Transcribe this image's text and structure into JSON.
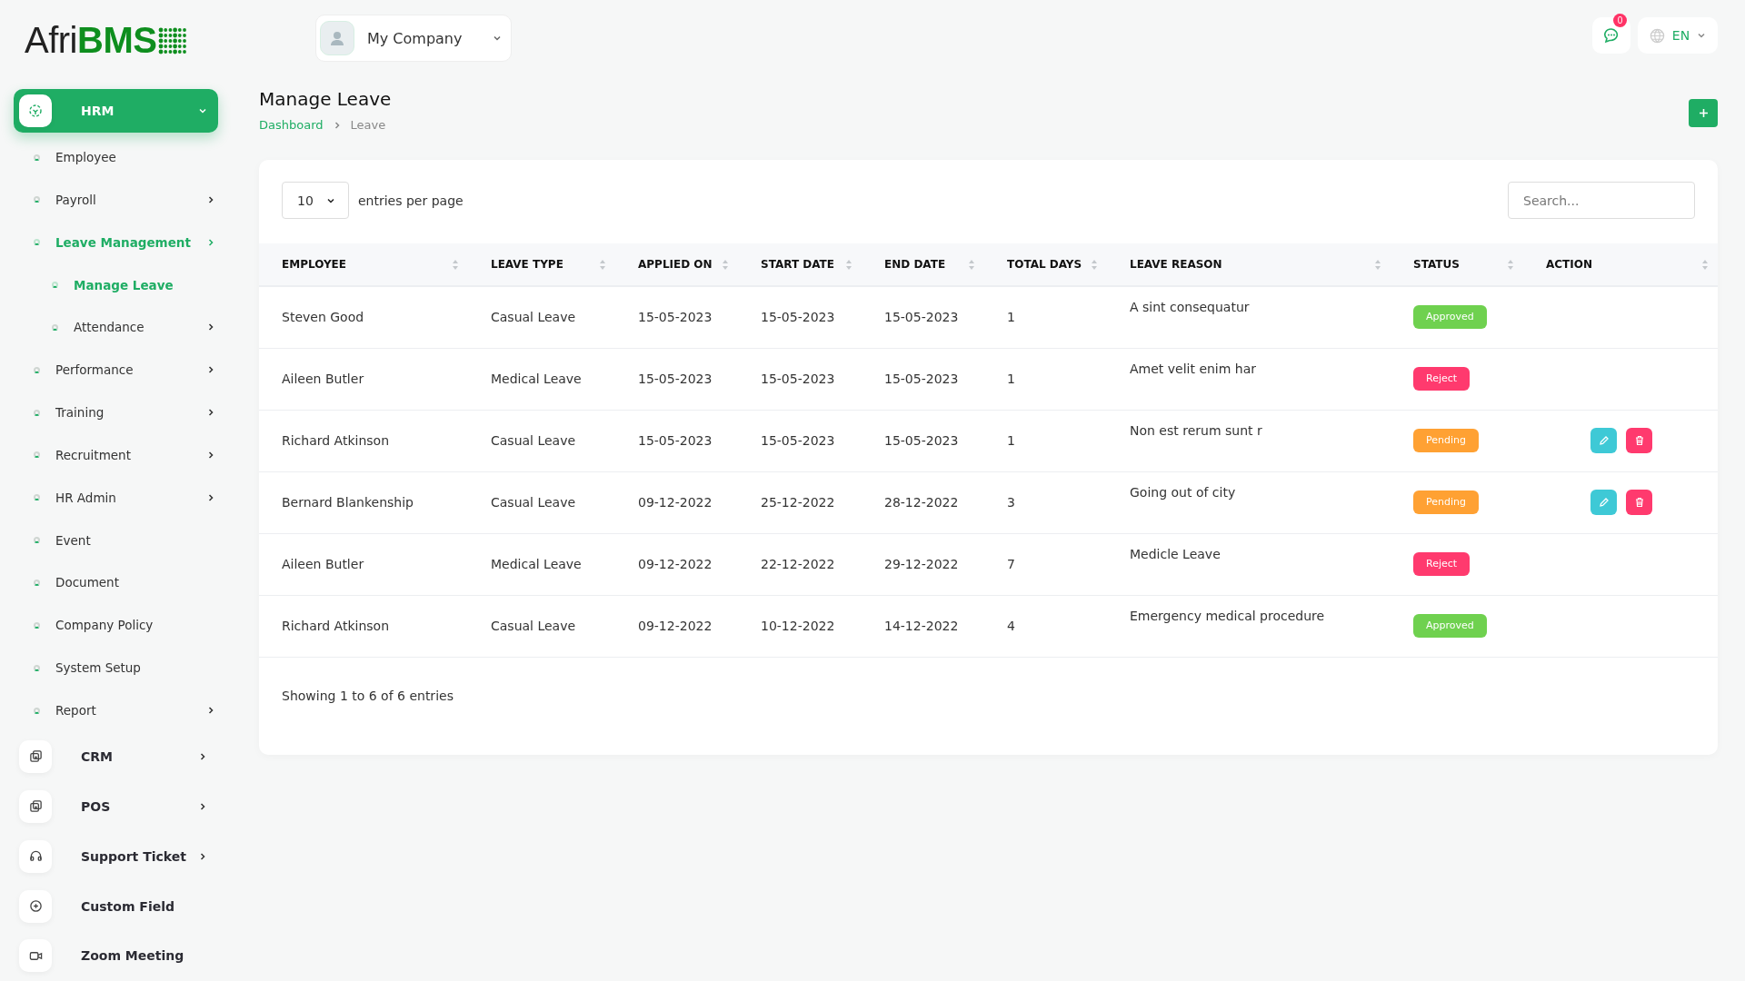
{
  "logo": {
    "light": "Afri",
    "bold": "BMS"
  },
  "company": {
    "name": "My Company"
  },
  "notifications": {
    "count": "0"
  },
  "language": {
    "code": "EN"
  },
  "sidebar": {
    "modules": [
      {
        "label": "HRM",
        "kind": "hrm",
        "selected": true,
        "expanded": true,
        "has_submenu": true,
        "children": [
          {
            "label": "Employee",
            "selected": false,
            "has_submenu": false
          },
          {
            "label": "Payroll",
            "selected": false,
            "has_submenu": true
          },
          {
            "label": "Leave Management",
            "selected": true,
            "has_submenu": true,
            "children": [
              {
                "label": "Manage Leave",
                "selected": true,
                "has_submenu": false
              },
              {
                "label": "Attendance",
                "selected": false,
                "has_submenu": true
              }
            ]
          },
          {
            "label": "Performance",
            "selected": false,
            "has_submenu": true
          },
          {
            "label": "Training",
            "selected": false,
            "has_submenu": true
          },
          {
            "label": "Recruitment",
            "selected": false,
            "has_submenu": true
          },
          {
            "label": "HR Admin",
            "selected": false,
            "has_submenu": true
          },
          {
            "label": "Event",
            "selected": false,
            "has_submenu": false
          },
          {
            "label": "Document",
            "selected": false,
            "has_submenu": false
          },
          {
            "label": "Company Policy",
            "selected": false,
            "has_submenu": false
          },
          {
            "label": "System Setup",
            "selected": false,
            "has_submenu": false
          },
          {
            "label": "Report",
            "selected": false,
            "has_submenu": true
          }
        ]
      },
      {
        "label": "CRM",
        "kind": "crm",
        "selected": false,
        "expanded": false,
        "has_submenu": true
      },
      {
        "label": "POS",
        "kind": "pos",
        "selected": false,
        "expanded": false,
        "has_submenu": true
      },
      {
        "label": "Support Ticket",
        "kind": "support",
        "selected": false,
        "expanded": false,
        "has_submenu": true
      },
      {
        "label": "Custom Field",
        "kind": "custom",
        "selected": false,
        "expanded": false,
        "has_submenu": false
      },
      {
        "label": "Zoom Meeting",
        "kind": "zoom",
        "selected": false,
        "expanded": false,
        "has_submenu": false
      }
    ]
  },
  "page": {
    "title": "Manage Leave",
    "breadcrumb": [
      "Dashboard",
      "Leave"
    ]
  },
  "table": {
    "page_size": "10",
    "page_size_label": "entries per page",
    "search": {
      "placeholder": "Search..."
    },
    "columns": [
      "EMPLOYEE",
      "LEAVE TYPE",
      "APPLIED ON",
      "START DATE",
      "END DATE",
      "TOTAL DAYS",
      "LEAVE REASON",
      "STATUS",
      "ACTION"
    ],
    "rows": [
      {
        "employee": "Steven Good",
        "leave_type": "Casual Leave",
        "applied_on": "15-05-2023",
        "start_date": "15-05-2023",
        "end_date": "15-05-2023",
        "total_days": "1",
        "reason": "A sint consequatur",
        "status": {
          "label": "Approved",
          "kind": "approved"
        },
        "editable": false
      },
      {
        "employee": "Aileen Butler",
        "leave_type": "Medical Leave",
        "applied_on": "15-05-2023",
        "start_date": "15-05-2023",
        "end_date": "15-05-2023",
        "total_days": "1",
        "reason": "Amet velit enim har",
        "status": {
          "label": "Reject",
          "kind": "reject"
        },
        "editable": false
      },
      {
        "employee": "Richard Atkinson",
        "leave_type": "Casual Leave",
        "applied_on": "15-05-2023",
        "start_date": "15-05-2023",
        "end_date": "15-05-2023",
        "total_days": "1",
        "reason": "Non est rerum sunt r",
        "status": {
          "label": "Pending",
          "kind": "pending"
        },
        "editable": true
      },
      {
        "employee": "Bernard Blankenship",
        "leave_type": "Casual Leave",
        "applied_on": "09-12-2022",
        "start_date": "25-12-2022",
        "end_date": "28-12-2022",
        "total_days": "3",
        "reason": "Going out of city",
        "status": {
          "label": "Pending",
          "kind": "pending"
        },
        "editable": true
      },
      {
        "employee": "Aileen Butler",
        "leave_type": "Medical Leave",
        "applied_on": "09-12-2022",
        "start_date": "22-12-2022",
        "end_date": "29-12-2022",
        "total_days": "7",
        "reason": "Medicle Leave",
        "status": {
          "label": "Reject",
          "kind": "reject"
        },
        "editable": false
      },
      {
        "employee": "Richard Atkinson",
        "leave_type": "Casual Leave",
        "applied_on": "09-12-2022",
        "start_date": "10-12-2022",
        "end_date": "14-12-2022",
        "total_days": "4",
        "reason": "Emergency medical procedure",
        "status": {
          "label": "Approved",
          "kind": "approved"
        },
        "editable": false
      }
    ],
    "footer": "Showing 1 to 6 of 6 entries"
  }
}
